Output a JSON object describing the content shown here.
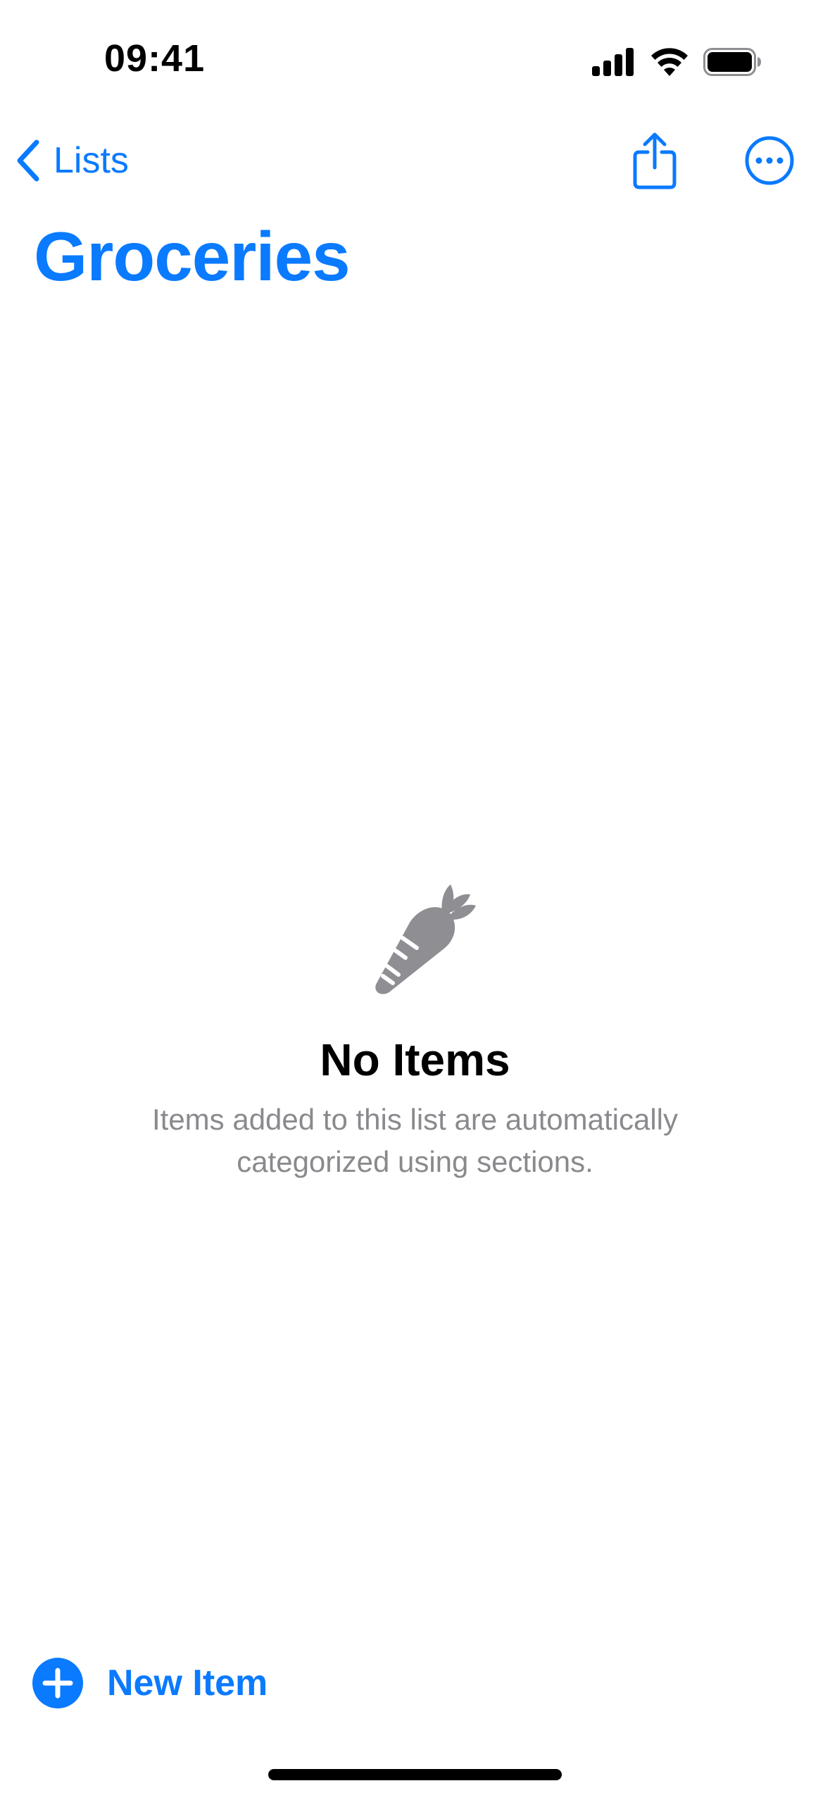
{
  "colors": {
    "accent": "#0a7aff",
    "secondary_text": "#8a8a8e",
    "empty_icon": "#8e8e93"
  },
  "status_bar": {
    "time": "09:41",
    "icons": [
      "cellular-signal-icon",
      "wifi-icon",
      "battery-icon"
    ]
  },
  "nav": {
    "back_label": "Lists",
    "back_icon": "chevron-left-icon",
    "share_icon": "share-icon",
    "more_icon": "ellipsis-circle-icon"
  },
  "page": {
    "title": "Groceries"
  },
  "empty_state": {
    "icon": "carrot-icon",
    "title": "No Items",
    "subtitle_line1": "Items added to this list are automatically",
    "subtitle_line2": "categorized using sections."
  },
  "toolbar": {
    "new_item_label": "New Item",
    "new_item_icon": "plus-circle-icon"
  }
}
